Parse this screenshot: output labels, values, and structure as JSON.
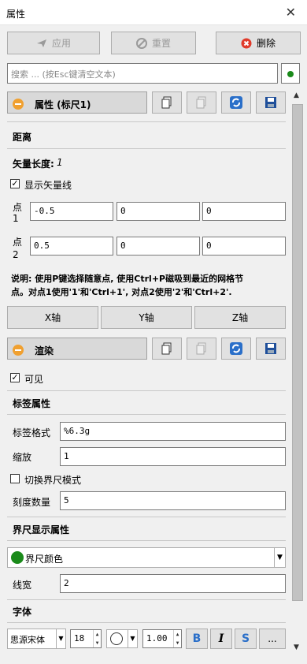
{
  "window": {
    "title": "属性",
    "close": "✕"
  },
  "toolbar": {
    "apply": "应用",
    "reset": "重置",
    "delete": "删除"
  },
  "search": {
    "placeholder": "搜索 ... (按Esc键清空文本)"
  },
  "props_group": {
    "title": "属性 (标尺1)"
  },
  "distance": {
    "heading": "距离",
    "vector_length_label": "矢量长度:",
    "vector_length_value": "1",
    "show_vector_label": "显示矢量线",
    "show_vector_checked": true,
    "point1_label_a": "点",
    "point1_label_b": "1",
    "point1": [
      "-0.5",
      "0",
      "0"
    ],
    "point2_label_a": "点",
    "point2_label_b": "2",
    "point2": [
      "0.5",
      "0",
      "0"
    ],
    "note_line1": "说明: 使用P键选择随意点, 使用Ctrl+P磁吸到最近的网格节",
    "note_line2": "点。对点1使用'1'和'Ctrl+1', 对点2使用'2'和'Ctrl+2'.",
    "x_axis": "X轴",
    "y_axis": "Y轴",
    "z_axis": "Z轴"
  },
  "render_group": {
    "title": "渲染"
  },
  "visible": {
    "label": "可见",
    "checked": true
  },
  "label_props": {
    "heading": "标签属性",
    "format_label": "标签格式",
    "format_value": "%6.3g",
    "scale_label": "缩放",
    "scale_value": "1",
    "toggle_label": "切换界尺模式",
    "toggle_checked": false,
    "ticks_label": "刻度数量",
    "ticks_value": "5"
  },
  "ruler_display": {
    "heading": "界尺显示属性",
    "color_label": "界尺颜色",
    "color": "#1a8a1a",
    "linewidth_label": "线宽",
    "linewidth_value": "2"
  },
  "font": {
    "heading": "字体",
    "family": "思源宋体",
    "size": "18",
    "opacity": "1.00",
    "bold": "B",
    "italic": "I",
    "shadow": "S",
    "more": "..."
  }
}
